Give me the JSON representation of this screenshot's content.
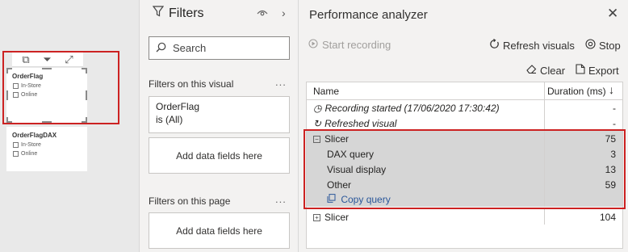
{
  "canvas": {
    "slicer1": {
      "title": "OrderFlag",
      "items": [
        "In-Store",
        "Online"
      ]
    },
    "slicer2": {
      "title": "OrderFlagDAX",
      "items": [
        "In-Store",
        "Online"
      ]
    },
    "visual_header_icons": [
      "focus-mode-icon",
      "filter-icon",
      "expand-icon"
    ]
  },
  "filters": {
    "title": "Filters",
    "search_placeholder": "Search",
    "on_visual_label": "Filters on this visual",
    "on_visual_more": "...",
    "card_field": "OrderFlag",
    "card_value": "is (All)",
    "add_fields_visual": "Add data fields here",
    "on_page_label": "Filters on this page",
    "on_page_more": "...",
    "add_fields_page": "Add data fields here"
  },
  "perf": {
    "title": "Performance analyzer",
    "start_recording": "Start recording",
    "refresh_visuals": "Refresh visuals",
    "stop": "Stop",
    "clear": "Clear",
    "export": "Export",
    "col_name": "Name",
    "col_duration": "Duration (ms)",
    "rows": [
      {
        "label": "Recording started (17/06/2020 17:30:42)",
        "duration": "-"
      },
      {
        "label": "Refreshed visual",
        "duration": "-"
      },
      {
        "label": "Slicer",
        "duration": "75"
      },
      {
        "label": "DAX query",
        "duration": "3"
      },
      {
        "label": "Visual display",
        "duration": "13"
      },
      {
        "label": "Other",
        "duration": "59"
      },
      {
        "label": "Copy query",
        "duration": ""
      },
      {
        "label": "Slicer",
        "duration": "104"
      }
    ]
  },
  "colors": {
    "highlight_border": "#cc2222",
    "link": "#2b579a",
    "row_selected": "#d6d6d6"
  }
}
